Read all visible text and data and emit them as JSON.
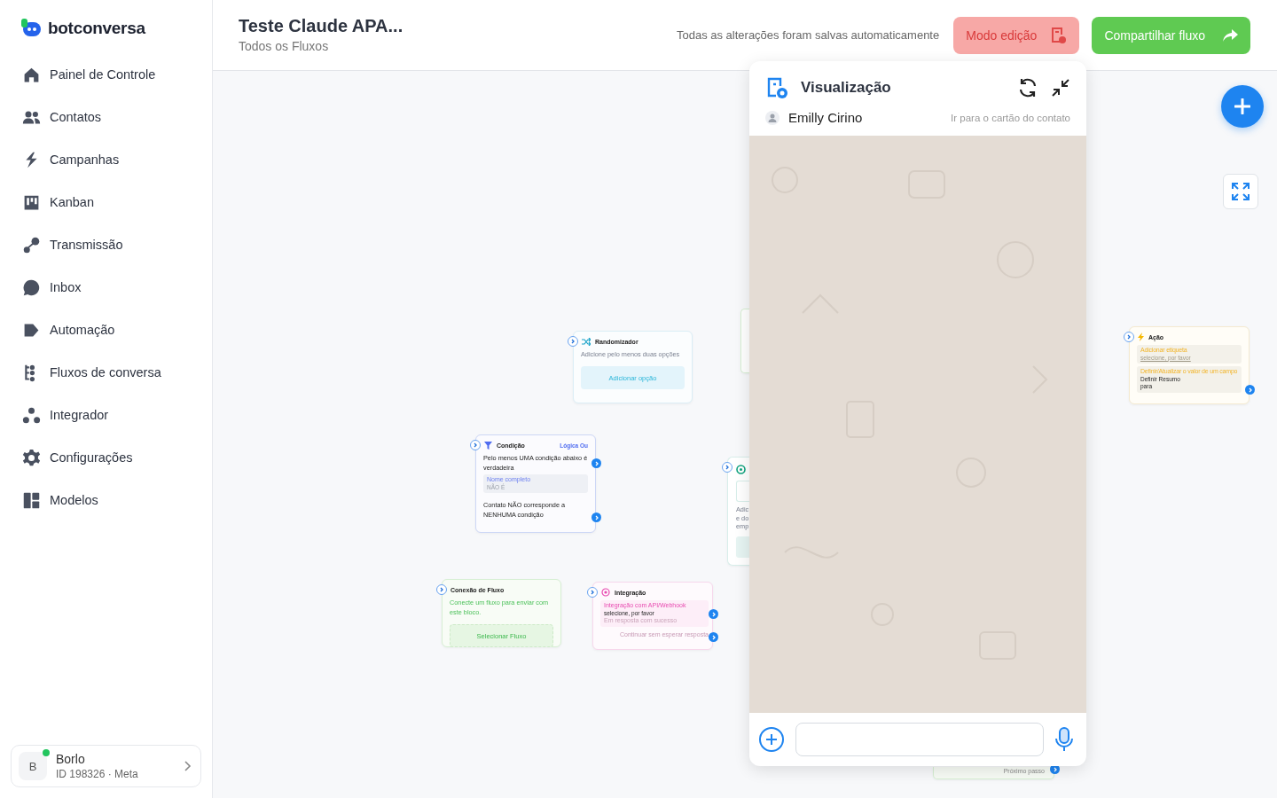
{
  "sidebar": {
    "logo": "botconversa",
    "items": [
      {
        "label": "Painel de Controle"
      },
      {
        "label": "Contatos"
      },
      {
        "label": "Campanhas"
      },
      {
        "label": "Kanban"
      },
      {
        "label": "Transmissão"
      },
      {
        "label": "Inbox"
      },
      {
        "label": "Automação"
      },
      {
        "label": "Fluxos de conversa"
      },
      {
        "label": "Integrador"
      },
      {
        "label": "Configurações"
      },
      {
        "label": "Modelos"
      }
    ],
    "account": {
      "avatar": "B",
      "name": "Borlo",
      "detail": "ID 198326 · Meta",
      "online": true
    }
  },
  "header": {
    "title": "Teste Claude APA...",
    "breadcrumb": "Todos os Fluxos",
    "save_status": "Todas as alterações foram salvas automaticamente",
    "buttons": [
      {
        "label": "Modo edição",
        "kind": "edit"
      },
      {
        "label": "Compartilhar fluxo",
        "kind": "share"
      }
    ]
  },
  "canvas": {
    "nodes": [
      {
        "kind": "randomizer",
        "title": "Randomizador",
        "text": "Adicione pelo menos duas opções",
        "button": "Adicionar opção"
      },
      {
        "kind": "condition",
        "title": "Condição",
        "badge": "Lógica Ou",
        "text": "Pelo menos UMA condição abaixo é verdadeira",
        "field_label": "Nome completo",
        "field_value": "NÃO É",
        "else_text": "Contato NÃO corresponde a NENHUMA condição"
      },
      {
        "kind": "flow",
        "title": "Conexão de Fluxo",
        "text": "Conecte um fluxo para enviar com este bloco.",
        "button": "Selecionar Fluxo"
      },
      {
        "kind": "integration",
        "title": "Integração",
        "label": "Integração com API/Webhook",
        "value": "selecione, por favor",
        "note": "Em resposta com sucesso",
        "footer": "Continuar sem esperar resposta"
      },
      {
        "kind": "action",
        "title": "Ação",
        "rows": [
          {
            "label": "Adicionar etiqueta",
            "lines": [
              "selecione, por favor"
            ],
            "placeholder": true
          },
          {
            "label": "Definir/Atualizar o valor de um campo",
            "lines": [
              "Definir Resumo",
              "para"
            ],
            "placeholder": false
          }
        ]
      },
      {
        "kind": "ai",
        "lines": [
          "Adic",
          "e do",
          "emp"
        ]
      },
      {
        "kind": "partial"
      },
      {
        "kind": "footer",
        "footer": "Próximo passo"
      }
    ]
  },
  "preview": {
    "title": "Visualização",
    "contact": "Emilly Cirino",
    "link": "Ir para o cartão do contato"
  }
}
